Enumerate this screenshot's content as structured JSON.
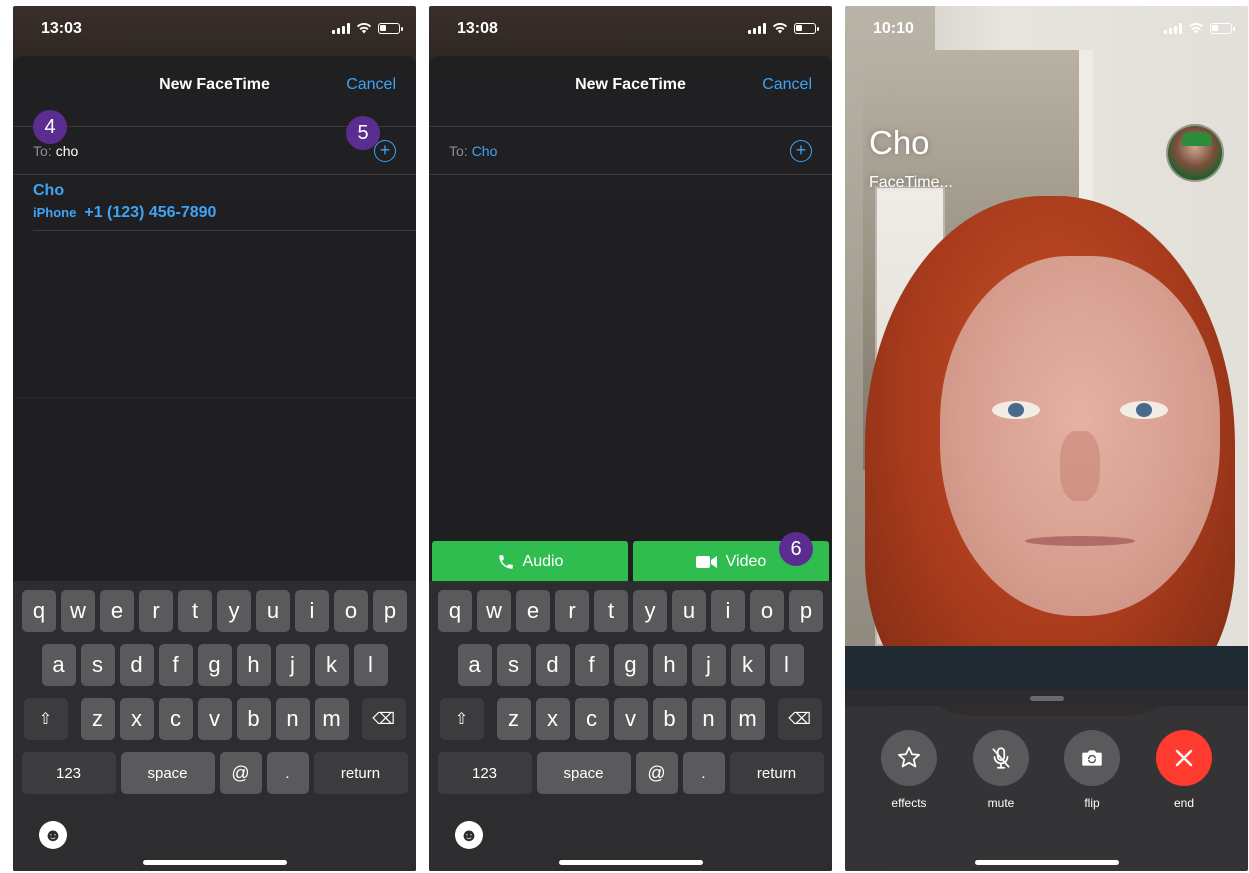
{
  "screen1": {
    "time": "13:03",
    "title": "New FaceTime",
    "cancel": "Cancel",
    "to_label": "To:",
    "to_value": "cho",
    "suggestion": {
      "name": "Cho",
      "device": "iPhone",
      "number": "+1 (123) 456-7890"
    },
    "badges": [
      "4",
      "5"
    ]
  },
  "screen2": {
    "time": "13:08",
    "title": "New FaceTime",
    "cancel": "Cancel",
    "to_label": "To:",
    "to_value": "Cho",
    "audio_label": "Audio",
    "video_label": "Video",
    "badge": "6"
  },
  "keyboard": {
    "row1": [
      "q",
      "w",
      "e",
      "r",
      "t",
      "y",
      "u",
      "i",
      "o",
      "p"
    ],
    "row2": [
      "a",
      "s",
      "d",
      "f",
      "g",
      "h",
      "j",
      "k",
      "l"
    ],
    "row3": [
      "z",
      "x",
      "c",
      "v",
      "b",
      "n",
      "m"
    ],
    "num_key": "123",
    "space_key": "space",
    "at_key": "@",
    "dot_key": ".",
    "return_key": "return",
    "shift_icon": "⇧",
    "delete_icon": "⌫",
    "emoji_icon": "☻"
  },
  "screen3": {
    "time": "10:10",
    "caller": "Cho",
    "status": "FaceTime...",
    "controls": [
      {
        "label": "effects",
        "icon": "star-icon"
      },
      {
        "label": "mute",
        "icon": "mic-slash-icon"
      },
      {
        "label": "flip",
        "icon": "camera-flip-icon"
      },
      {
        "label": "end",
        "icon": "close-icon"
      }
    ]
  },
  "colors": {
    "link_blue": "#3fa4f5",
    "green": "#2fbd4f",
    "badge_purple": "#5c2d91",
    "end_red": "#ff3b30"
  }
}
